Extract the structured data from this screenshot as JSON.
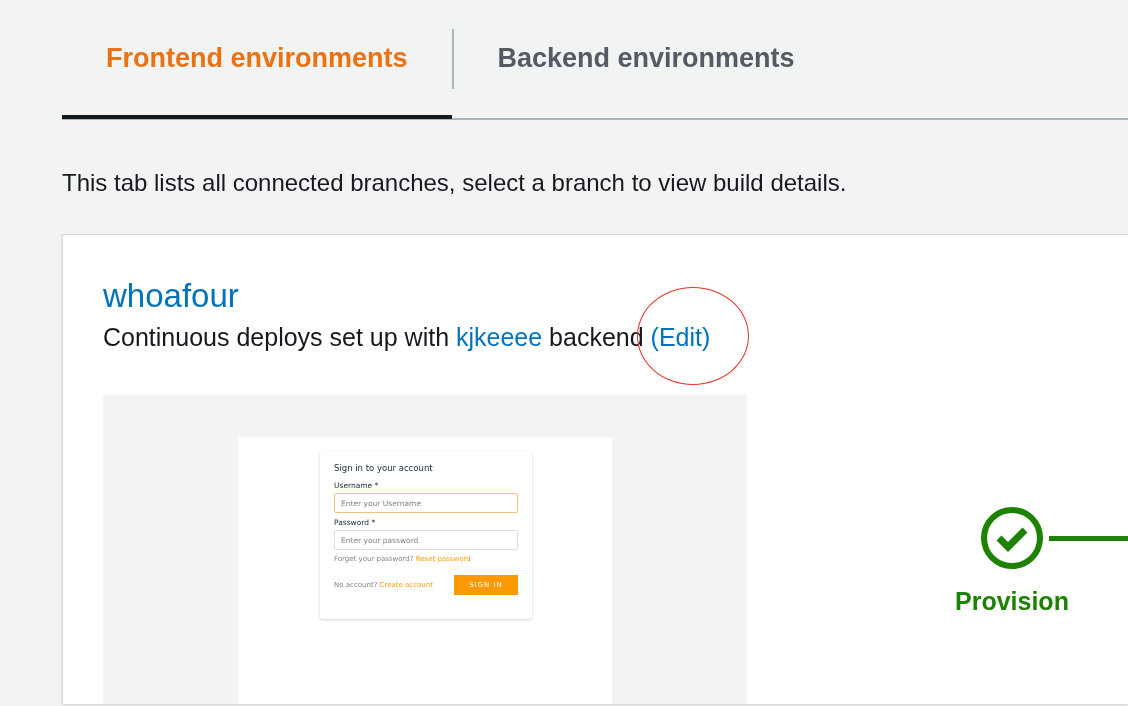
{
  "tabs": [
    {
      "label": "Frontend environments",
      "selected": true
    },
    {
      "label": "Backend environments",
      "selected": false
    }
  ],
  "description": "This tab lists all connected branches, select a branch to view build details.",
  "branch": {
    "name": "whoafour",
    "subtitle": {
      "before": "Continuous deploys set up with",
      "backend_link": "kjkeeee",
      "after": "backend",
      "edit_link": "(Edit)"
    },
    "annotated": true,
    "preview": {
      "title": "Sign in to your account",
      "username_label": "Username *",
      "username_placeholder": "Enter your Username",
      "username_focused": true,
      "password_label": "Password *",
      "password_placeholder": "Enter your password",
      "forgot_text": "Forget your password?",
      "reset_link": "Reset password",
      "no_account_text": "No account?",
      "create_link": "Create account",
      "sign_in_button": "SIGN IN"
    },
    "pipeline": [
      {
        "label": "Provision",
        "succeeded": true
      }
    ]
  }
}
